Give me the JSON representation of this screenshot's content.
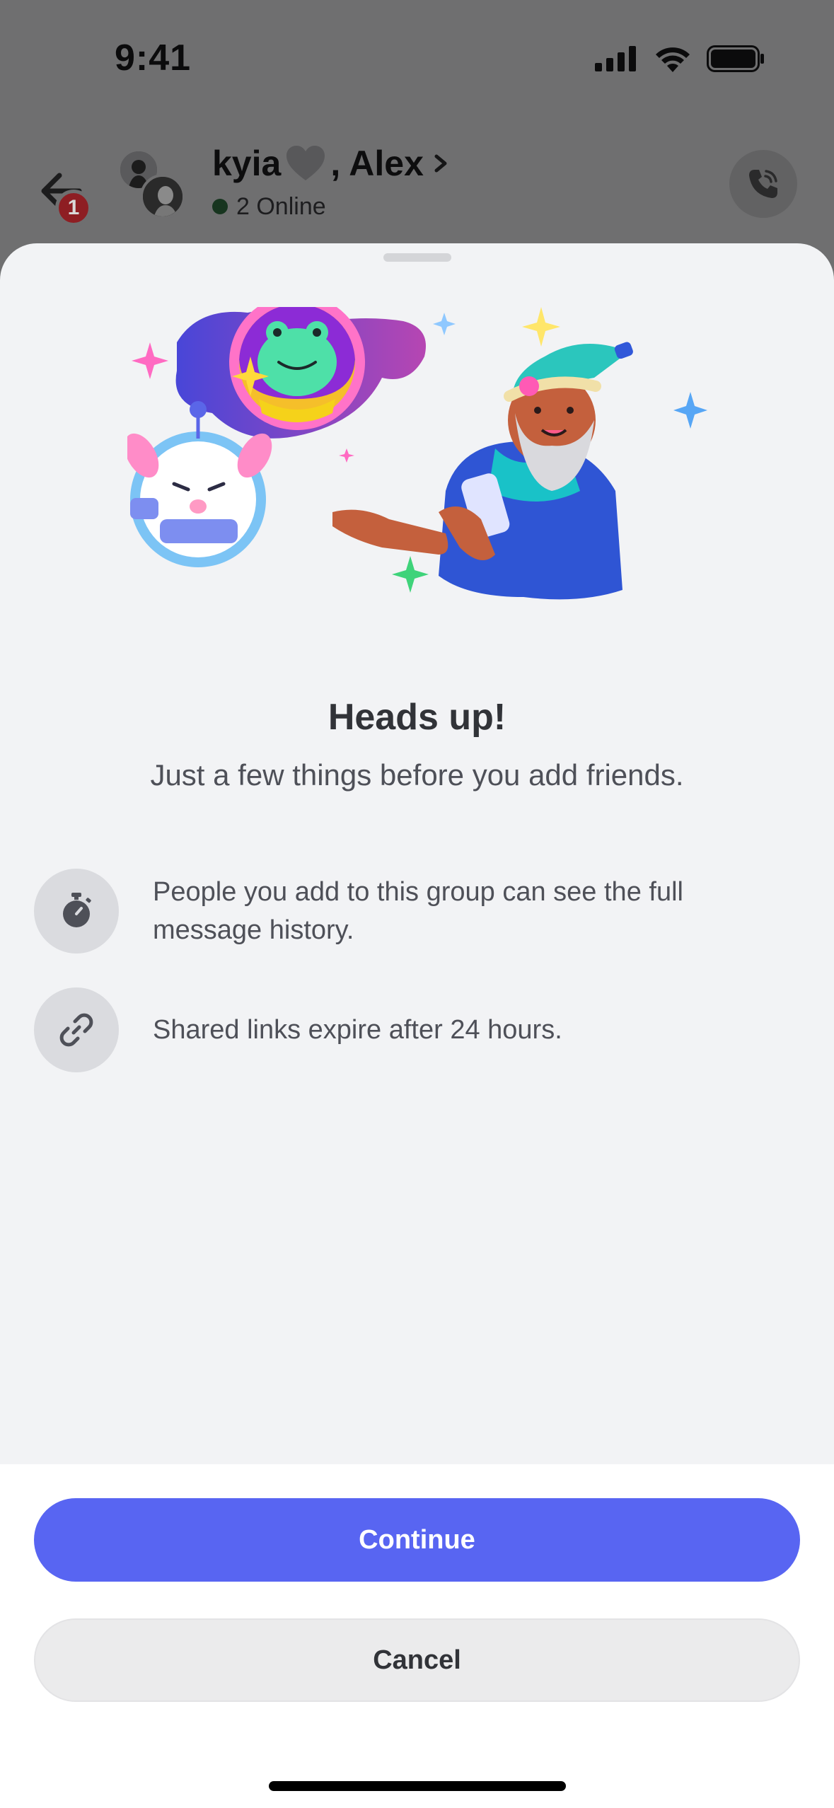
{
  "status_bar": {
    "time": "9:41"
  },
  "chat_header": {
    "unread_count": "1",
    "title_name": "kyia",
    "title_rest": ", Alex",
    "online_status": "2 Online"
  },
  "sheet": {
    "title": "Heads up!",
    "subtitle": "Just a few things before you add friends.",
    "info_items": [
      {
        "icon": "stopwatch-icon",
        "text": "People you add to this group can see the full message history."
      },
      {
        "icon": "link-icon",
        "text": "Shared links expire after 24 hours."
      }
    ]
  },
  "footer": {
    "continue_label": "Continue",
    "cancel_label": "Cancel"
  },
  "colors": {
    "primary": "#5865f2",
    "sheet_bg": "#f2f3f5",
    "badge_red": "#8e1e23"
  }
}
